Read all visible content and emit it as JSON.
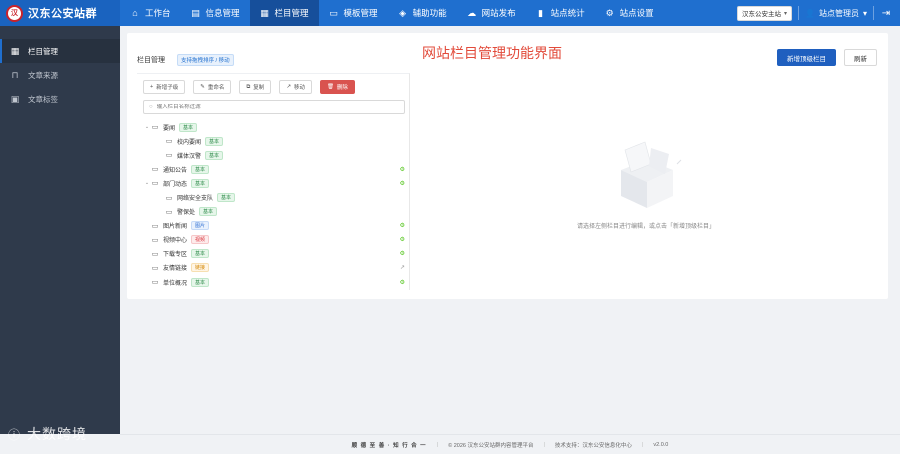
{
  "brand": {
    "logo_text": "汉",
    "title": "汉东公安站群"
  },
  "nav": [
    {
      "label": "工作台",
      "icon": "home-icon"
    },
    {
      "label": "信息管理",
      "icon": "document-icon"
    },
    {
      "label": "栏目管理",
      "icon": "grid-icon"
    },
    {
      "label": "模板管理",
      "icon": "template-icon"
    },
    {
      "label": "辅助功能",
      "icon": "tag-icon"
    },
    {
      "label": "网站发布",
      "icon": "cloud-icon"
    },
    {
      "label": "站点统计",
      "icon": "chart-icon"
    },
    {
      "label": "站点设置",
      "icon": "gear-icon"
    }
  ],
  "header_right": {
    "site_select": "汉东公安主站",
    "user": "站点管理员"
  },
  "sidebar": [
    {
      "label": "栏目管理",
      "icon": "grid-icon"
    },
    {
      "label": "文章来源",
      "icon": "bookmark-icon"
    },
    {
      "label": "文章标签",
      "icon": "clipboard-icon"
    }
  ],
  "card": {
    "title": "栏目管理",
    "drag_hint": "支持拖拽排序 / 移动",
    "headline": "网站栏目管理功能界面",
    "primary_button": "新增顶级栏目",
    "refresh_button": "刷新"
  },
  "toolbar": {
    "add_child": "新增子级",
    "rename": "重命名",
    "copy": "复制",
    "move": "移动",
    "delete": "删除"
  },
  "search": {
    "placeholder": "输入栏目名称过滤"
  },
  "tree": [
    {
      "label": "要闻",
      "badge": "基本",
      "badge_type": "basic",
      "level": 0,
      "expanded": true,
      "action": ""
    },
    {
      "label": "校内要闻",
      "badge": "基本",
      "badge_type": "basic",
      "level": 1,
      "expanded": null,
      "action": ""
    },
    {
      "label": "媒体汉警",
      "badge": "基本",
      "badge_type": "basic",
      "level": 1,
      "expanded": null,
      "action": ""
    },
    {
      "label": "通知公告",
      "badge": "基本",
      "badge_type": "basic",
      "level": 0,
      "expanded": null,
      "action": "gear"
    },
    {
      "label": "部门动态",
      "badge": "基本",
      "badge_type": "basic",
      "level": 0,
      "expanded": true,
      "action": "gear"
    },
    {
      "label": "网络安全支队",
      "badge": "基本",
      "badge_type": "basic",
      "level": 1,
      "expanded": null,
      "action": ""
    },
    {
      "label": "警保处",
      "badge": "基本",
      "badge_type": "basic",
      "level": 1,
      "expanded": null,
      "action": ""
    },
    {
      "label": "图片新闻",
      "badge": "图片",
      "badge_type": "image",
      "level": 0,
      "expanded": null,
      "action": "gear"
    },
    {
      "label": "视频中心",
      "badge": "视频",
      "badge_type": "video",
      "level": 0,
      "expanded": null,
      "action": "gear"
    },
    {
      "label": "下载专区",
      "badge": "基本",
      "badge_type": "basic",
      "level": 0,
      "expanded": null,
      "action": "gear"
    },
    {
      "label": "友情链接",
      "badge": "链接",
      "badge_type": "link",
      "level": 0,
      "expanded": null,
      "action": "link"
    },
    {
      "label": "单位概况",
      "badge": "基本",
      "badge_type": "basic",
      "level": 0,
      "expanded": null,
      "action": "gear"
    }
  ],
  "empty_state": {
    "text": "请选择左侧栏目进行编辑，或点击「新增顶级栏目」"
  },
  "footer": {
    "slogan": "顺 德 至 善 · 知 行 合 一",
    "copyright": "© 2026 汉东公安站群内容管理平台",
    "support": "技术支持：汉东公安信息化中心",
    "version": "v2.0.0"
  },
  "watermark": {
    "text": "大数跨境"
  },
  "colors": {
    "primary": "#1f6fcf",
    "sidebar": "#2f3a4b",
    "danger": "#d9534f",
    "headline": "#e24b3b"
  }
}
